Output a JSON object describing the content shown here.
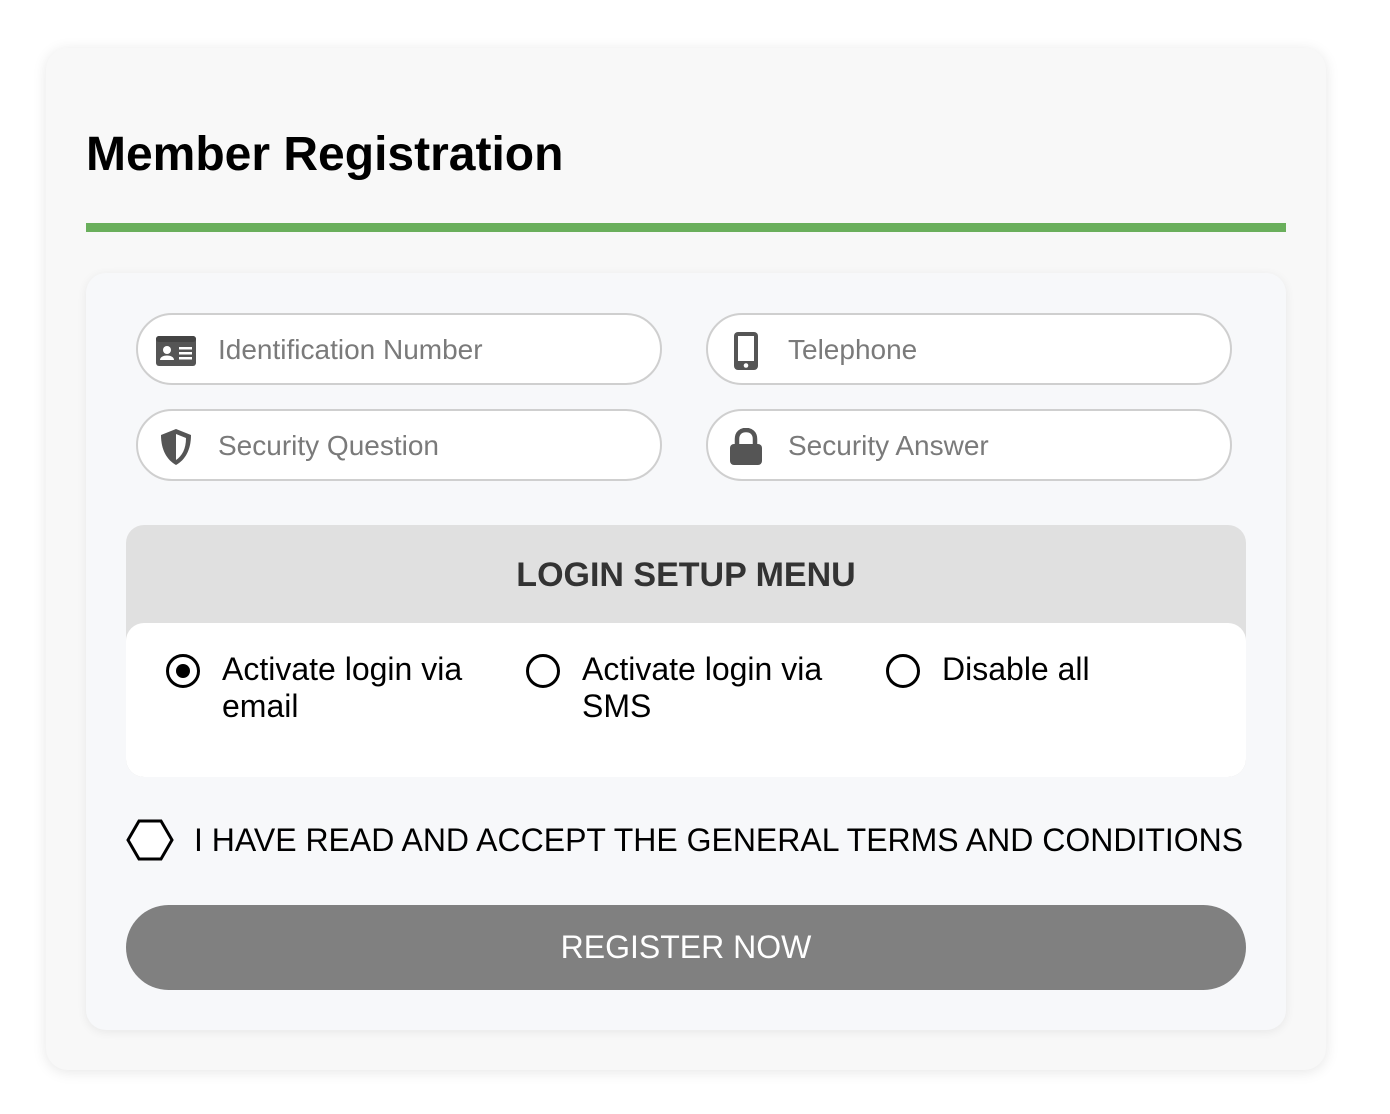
{
  "page": {
    "title": "Member Registration",
    "accent_color": "#6aaf5c"
  },
  "fields": {
    "identification": {
      "placeholder": "Identification Number",
      "value": "",
      "icon": "id-card-icon"
    },
    "telephone": {
      "placeholder": "Telephone",
      "value": "",
      "icon": "mobile-phone-icon"
    },
    "security_question": {
      "placeholder": "Security Question",
      "value": "",
      "icon": "shield-icon"
    },
    "security_answer": {
      "placeholder": "Security Answer",
      "value": "",
      "icon": "lock-icon"
    }
  },
  "login_menu": {
    "heading": "LOGIN SETUP MENU",
    "options": [
      {
        "label": "Activate login via email",
        "selected": true
      },
      {
        "label": "Activate login via SMS",
        "selected": false
      },
      {
        "label": "Disable all",
        "selected": false
      }
    ]
  },
  "terms": {
    "label": "I HAVE READ AND ACCEPT THE GENERAL TERMS AND CONDITIONS",
    "checked": false
  },
  "submit": {
    "label": "REGISTER NOW",
    "color": "#808080"
  }
}
